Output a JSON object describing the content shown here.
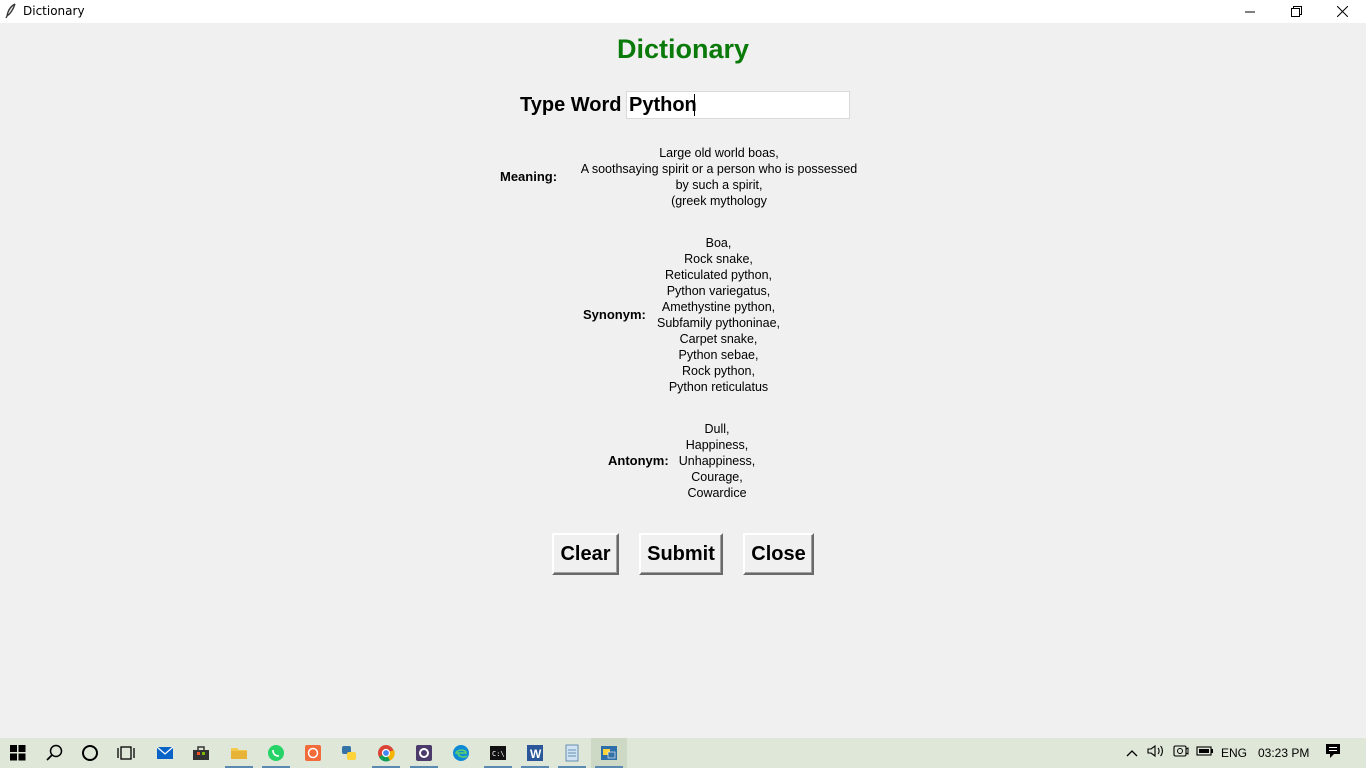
{
  "window": {
    "title": "Dictionary",
    "icon": "feather-icon",
    "controls": [
      "minimize-icon",
      "restore-icon",
      "close-icon"
    ]
  },
  "app": {
    "heading": "Dictionary",
    "heading_color": "#0a7a0a",
    "type_word_label": "Type Word",
    "word_value": "Python"
  },
  "meaning": {
    "label": "Meaning:",
    "text": "Large old world boas,\nA soothsaying spirit or a person who is possessed\nby such a spirit,\n(greek mythology"
  },
  "synonym": {
    "label": "Synonym:",
    "text": "Boa,\nRock snake,\nReticulated python,\nPython variegatus,\nAmethystine python,\nSubfamily pythoninae,\nCarpet snake,\nPython sebae,\nRock python,\nPython reticulatus"
  },
  "antonym": {
    "label": "Antonym:",
    "text": "Dull,\nHappiness,\nUnhappiness,\nCourage,\nCowardice"
  },
  "buttons": {
    "clear": "Clear",
    "submit": "Submit",
    "close": "Close"
  },
  "taskbar": {
    "apps": [
      "windows-start-icon",
      "search-icon",
      "cortana-icon",
      "task-view-icon",
      "mail-icon",
      "store-icon",
      "file-explorer-icon",
      "whatsapp-icon",
      "app-orange-icon",
      "python-icon",
      "chrome-icon",
      "app-gear-icon",
      "edge-icon",
      "terminal-icon",
      "word-icon",
      "notepad-icon",
      "python-window-icon"
    ],
    "language": "ENG",
    "time": "03:23 PM"
  }
}
